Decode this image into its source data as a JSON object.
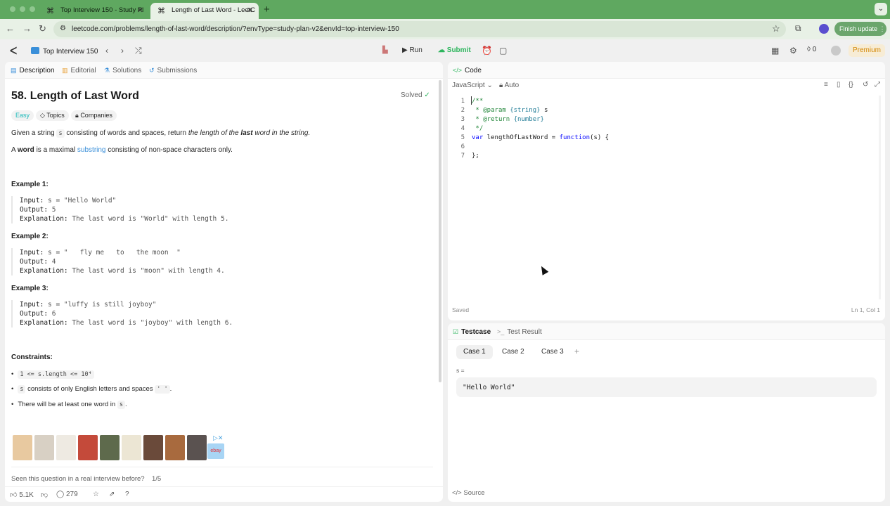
{
  "browser": {
    "tabs": [
      {
        "title": "Top Interview 150 - Study Pl",
        "active": false
      },
      {
        "title": "Length of Last Word - LeetC",
        "active": true
      }
    ],
    "url": "leetcode.com/problems/length-of-last-word/description/?envType=study-plan-v2&envId=top-interview-150",
    "update_label": "Finish update"
  },
  "header": {
    "list_name": "Top Interview 150",
    "run_label": "Run",
    "submit_label": "Submit",
    "streak_count": "0",
    "premium_label": "Premium"
  },
  "left_tabs": [
    {
      "label": "Description"
    },
    {
      "label": "Editorial"
    },
    {
      "label": "Solutions"
    },
    {
      "label": "Submissions"
    }
  ],
  "problem": {
    "title": "58. Length of Last Word",
    "status": "Solved",
    "difficulty": "Easy",
    "topics_label": "Topics",
    "companies_label": "Companies",
    "desc1_a": "Given a string ",
    "desc1_code": "s",
    "desc1_b": " consisting of words and spaces, return ",
    "desc1_c": "the length of the ",
    "desc1_d": "last",
    "desc1_e": " word in the string.",
    "desc2_a": "A ",
    "desc2_b": "word",
    "desc2_c": " is a maximal ",
    "desc2_link": "substring",
    "desc2_d": " consisting of non-space characters only.",
    "examples": [
      {
        "title": "Example 1:",
        "input": " s = \"Hello World\"",
        "output": " 5",
        "explanation": " The last word is \"World\" with length 5."
      },
      {
        "title": "Example 2:",
        "input": " s = \"   fly me   to   the moon  \"",
        "output": " 4",
        "explanation": " The last word is \"moon\" with length 4."
      },
      {
        "title": "Example 3:",
        "input": " s = \"luffy is still joyboy\"",
        "output": " 6",
        "explanation": " The last word is \"joyboy\" with length 6."
      }
    ],
    "input_label": "Input:",
    "output_label": "Output:",
    "explanation_label": "Explanation:",
    "constraints_title": "Constraints:",
    "c1_code": "1 <= s.length <= 10⁴",
    "c2_code": "s",
    "c2_text": " consists of only English letters and spaces ",
    "c2_code2": "' '",
    "c2_end": ".",
    "c3_text": "There will be at least one word in ",
    "c3_code": "s",
    "c3_end": ".",
    "seen_question": "Seen this question in a real interview before?",
    "seen_count": "1/5",
    "likes": "5.1K",
    "comments": "279"
  },
  "code_panel": {
    "tab_label": "Code",
    "language": "JavaScript",
    "auto_label": "Auto",
    "saved_label": "Saved",
    "cursor_pos": "Ln 1, Col 1",
    "line_numbers": [
      "1",
      "2",
      "3",
      "4",
      "5",
      "6",
      "7"
    ],
    "code": {
      "l1": "/**",
      "l2_a": " * ",
      "l2_b": "@param",
      "l2_c": " {string}",
      "l2_d": " s",
      "l3_a": " * ",
      "l3_b": "@return",
      "l3_c": " {number}",
      "l4": " */",
      "l5_a": "var",
      "l5_b": " lengthOfLastWord = ",
      "l5_c": "function",
      "l5_d": "(s) {",
      "l7": "};"
    }
  },
  "testcase_panel": {
    "tab_label": "Testcase",
    "result_label": "Test Result",
    "cases": [
      "Case 1",
      "Case 2",
      "Case 3"
    ],
    "add_label": "+",
    "param_label": "s =",
    "param_value": "\"Hello World\"",
    "source_label": "Source"
  }
}
